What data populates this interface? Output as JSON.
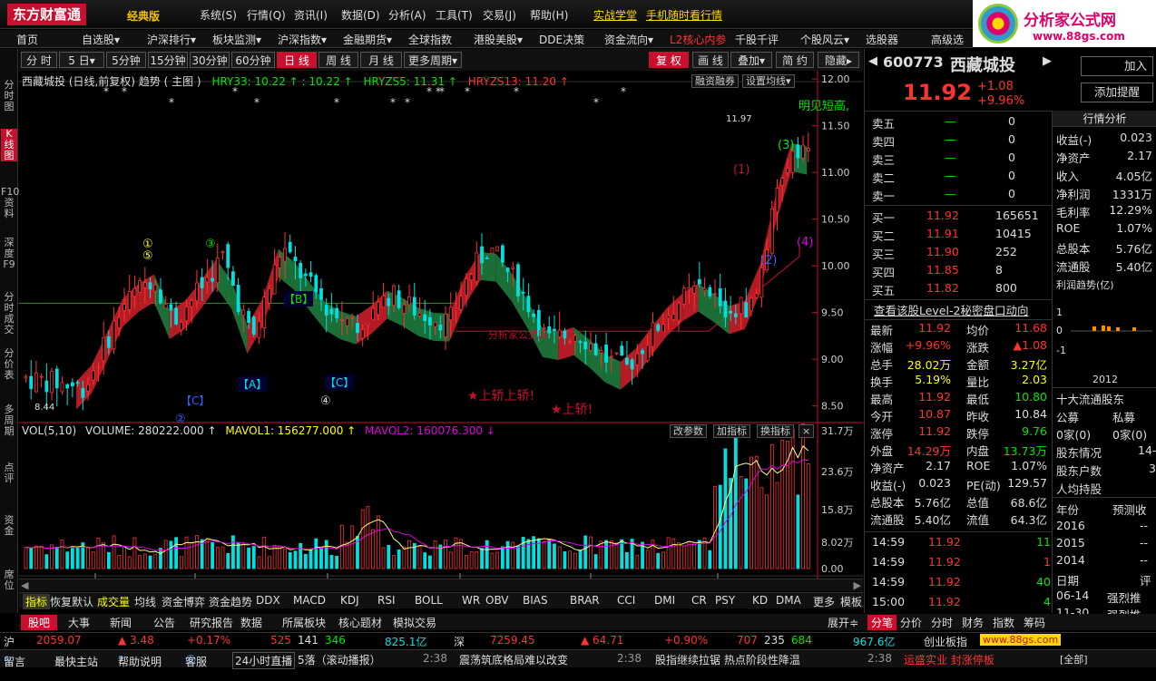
{
  "app": {
    "logo": "东方财富通",
    "edition": "经典版",
    "brand": "分析家公式网",
    "brand_url": "www.88gs.com",
    "menus": [
      "系统(S)",
      "行情(Q)",
      "资讯(I)",
      "数据(D)",
      "分析(A)",
      "工具(T)",
      "交易(J)",
      "帮助(H)"
    ],
    "links": [
      "实战学堂",
      "手机随时看行情"
    ]
  },
  "nav": [
    "首页",
    "自选股▾",
    "沪深排行▾",
    "板块监测▾",
    "沪深指数▾",
    "金融期货▾",
    "全球指数",
    "港股美股▾",
    "DDE决策",
    "资金流向▾",
    "L2核心内参",
    "千股千评",
    "个股风云▾",
    "选股器",
    "高级选股"
  ],
  "left_tabs": [
    "分时图",
    "K线图",
    "F10资料",
    "深度F9",
    "分时成交",
    "分价表",
    "多周期",
    "点评",
    "资金",
    "席位"
  ],
  "periods": [
    "分 时",
    "5 日▾",
    "5分钟",
    "15分钟",
    "30分钟",
    "60分钟",
    "日 线",
    "周 线",
    "月 线",
    "更多周期▾"
  ],
  "tools": [
    "复 权",
    "画 线",
    "叠加▾",
    "简 约",
    "隐藏▸"
  ],
  "chart_head": {
    "title": "西藏城投 (日线,前复权) 趋势 ( 主图 )",
    "hry33": "HRY33: 10.22 ↑ : 10.22 ↑",
    "hryzs5": "HRYZS5: 11.31 ↑",
    "hryzs13": "HRYZS13: 11.20 ↑",
    "btn1": "融资融券",
    "btn2": "设置均线▾"
  },
  "annot": {
    "top_right": "明见短高,",
    "high": "11.97",
    "low": "8.44",
    "watermark": "分析家公式网",
    "shangjiao1": "★上轿上轿!",
    "shangjiao2": "★上轿!",
    "b": "【B】",
    "a": "【A】",
    "c1": "【C】",
    "c2": "【C】",
    "n1": "①",
    "n3": "③",
    "n5": "⑤",
    "n4": "④",
    "n2": "②",
    "p1": "(1)",
    "p2": "(2)",
    "p3": "(3)",
    "p4": "(4)"
  },
  "vol_head": {
    "vol": "VOL(5,10)",
    "volume": "VOLUME: 280222.000 ↑",
    "mavol1": "MAVOL1: 156277.000 ↑",
    "mavol2": "MAVOL2: 160076.300 ↓",
    "btns": [
      "改参数",
      "加指标",
      "换指标",
      "×"
    ]
  },
  "chart_data": {
    "type": "candlestick",
    "ylim": [
      8.4,
      12.05
    ],
    "yticks": [
      "12.00",
      "11.50",
      "11.00",
      "10.50",
      "10.00",
      "9.50",
      "9.00",
      "8.50"
    ],
    "vol_ticks": [
      "31.7万",
      "23.6万",
      "15.8万",
      "8.02万",
      "0.00"
    ],
    "months": [
      "02",
      "03",
      "04",
      "05",
      "06",
      "07"
    ]
  },
  "indicators": [
    "指标",
    "恢复默认",
    "成交量",
    "均线",
    "资金博弈",
    "资金趋势",
    "DDX",
    "MACD",
    "KDJ",
    "RSI",
    "BOLL",
    "WR",
    "OBV",
    "BIAS",
    "BRAR",
    "CCI",
    "DMI",
    "CR",
    "PSY",
    "KD",
    "DMA",
    "更多",
    "模板"
  ],
  "bottom_tabs": [
    "股吧",
    "大事",
    "新闻",
    "公告",
    "研究报告",
    "数据",
    "所属板块",
    "核心题材",
    "模拟交易"
  ],
  "bottom_right": [
    "展开≑",
    "分笔",
    "分价",
    "分时",
    "财务",
    "指数",
    "筹码"
  ],
  "quote": {
    "code": "600773",
    "name": "西藏城投",
    "price": "11.92",
    "chg": "+1.08",
    "pct": "+9.96%",
    "btn_add": "加入",
    "btn_alert": "添加提醒",
    "asks": [
      [
        "卖五",
        "—",
        "0"
      ],
      [
        "卖四",
        "—",
        "0"
      ],
      [
        "卖三",
        "—",
        "0"
      ],
      [
        "卖二",
        "—",
        "0"
      ],
      [
        "卖一",
        "—",
        "0"
      ]
    ],
    "bids": [
      [
        "买一",
        "11.92",
        "165651"
      ],
      [
        "买二",
        "11.91",
        "10415"
      ],
      [
        "买三",
        "11.90",
        "252"
      ],
      [
        "买四",
        "11.85",
        "8"
      ],
      [
        "买五",
        "11.82",
        "800"
      ]
    ],
    "level2": "查看该股Level-2秘密盘口动向",
    "stats": [
      [
        "最新",
        "11.92",
        "均价",
        "11.68"
      ],
      [
        "涨幅",
        "+9.96%",
        "涨跌",
        "▲1.08"
      ],
      [
        "总手",
        "28.02万",
        "金额",
        "3.27亿"
      ],
      [
        "换手",
        "5.19%",
        "量比",
        "2.03"
      ],
      [
        "最高",
        "11.92",
        "最低",
        "10.80"
      ],
      [
        "今开",
        "10.87",
        "昨收",
        "10.84"
      ],
      [
        "涨停",
        "11.92",
        "跌停",
        "9.76"
      ],
      [
        "外盘",
        "14.29万",
        "内盘",
        "13.73万"
      ],
      [
        "净资产",
        "2.17",
        "ROE",
        "1.07%"
      ],
      [
        "收益(-)",
        "0.023",
        "PE(动)",
        "129.57"
      ],
      [
        "总股本",
        "5.76亿",
        "总值",
        "68.6亿"
      ],
      [
        "流通股",
        "5.40亿",
        "流值",
        "64.3亿"
      ]
    ],
    "ticks": [
      [
        "14:59",
        "11.92",
        "11"
      ],
      [
        "14:59",
        "11.92",
        "1"
      ],
      [
        "14:59",
        "11.92",
        "40"
      ],
      [
        "15:00",
        "11.92",
        "4"
      ]
    ]
  },
  "right_panel": {
    "tab": "行情分析",
    "rows": [
      [
        "收益(-)",
        "0.023"
      ],
      [
        "净资产",
        "2.17"
      ],
      [
        "收入",
        "4.05亿"
      ],
      [
        "净利润",
        "1331万"
      ],
      [
        "毛利率",
        "12.29%"
      ],
      [
        "ROE",
        "1.07%"
      ],
      [
        "总股本",
        "5.76亿"
      ],
      [
        "流通股",
        "5.40亿"
      ]
    ],
    "trend": "利润趋势(亿)",
    "year": "2012",
    "holders": "十大流通股东",
    "h1": "公募",
    "h2": "私募",
    "h3": "0家(0)",
    "h4": "0家(0)",
    "gd": "股东情况",
    "gdv": "14-0",
    "gdhs": "股东户数",
    "gdv2": "3",
    "rjcg": "人均持股",
    "rjv": "",
    "yl": "年份",
    "yc": "预测收",
    "years": [
      "2016",
      "2015",
      "2014"
    ],
    "rq": "日期",
    "pj": "评",
    "d1": "06-14",
    "d1v": "强烈推",
    "d2": "11-30",
    "d2v": "强烈推"
  },
  "ticker": {
    "sh_label": "沪",
    "sh": "2059.07",
    "sh_chg": "▲ 3.48",
    "sh_pct": "+0.17%",
    "sh_ud": "525",
    "sh_f": "141",
    "sh_d": "346",
    "sh_amt": "825.1亿",
    "sz_label": "深",
    "sz": "7259.45",
    "sz_chg": "▲ 64.71",
    "sz_pct": "+0.90%",
    "sz_ud": "707",
    "sz_f": "235",
    "sz_d": "684",
    "sz_amt": "967.6亿",
    "cy": "创业板指"
  },
  "status": {
    "s1": "留言",
    "s2": "最快主站",
    "s3": "帮助说明",
    "s4": "客服",
    "s5": "24小时直播",
    "s6": "5落（滚动播报）",
    "t1": "2:38",
    "n1": "震荡筑底格局难以改变",
    "t2": "2:38",
    "n2": "股指继续拉锯  热点阶段性降温",
    "t3": "2:38",
    "n3": "运盛实业  封涨停板",
    "s7": "[全部]"
  }
}
